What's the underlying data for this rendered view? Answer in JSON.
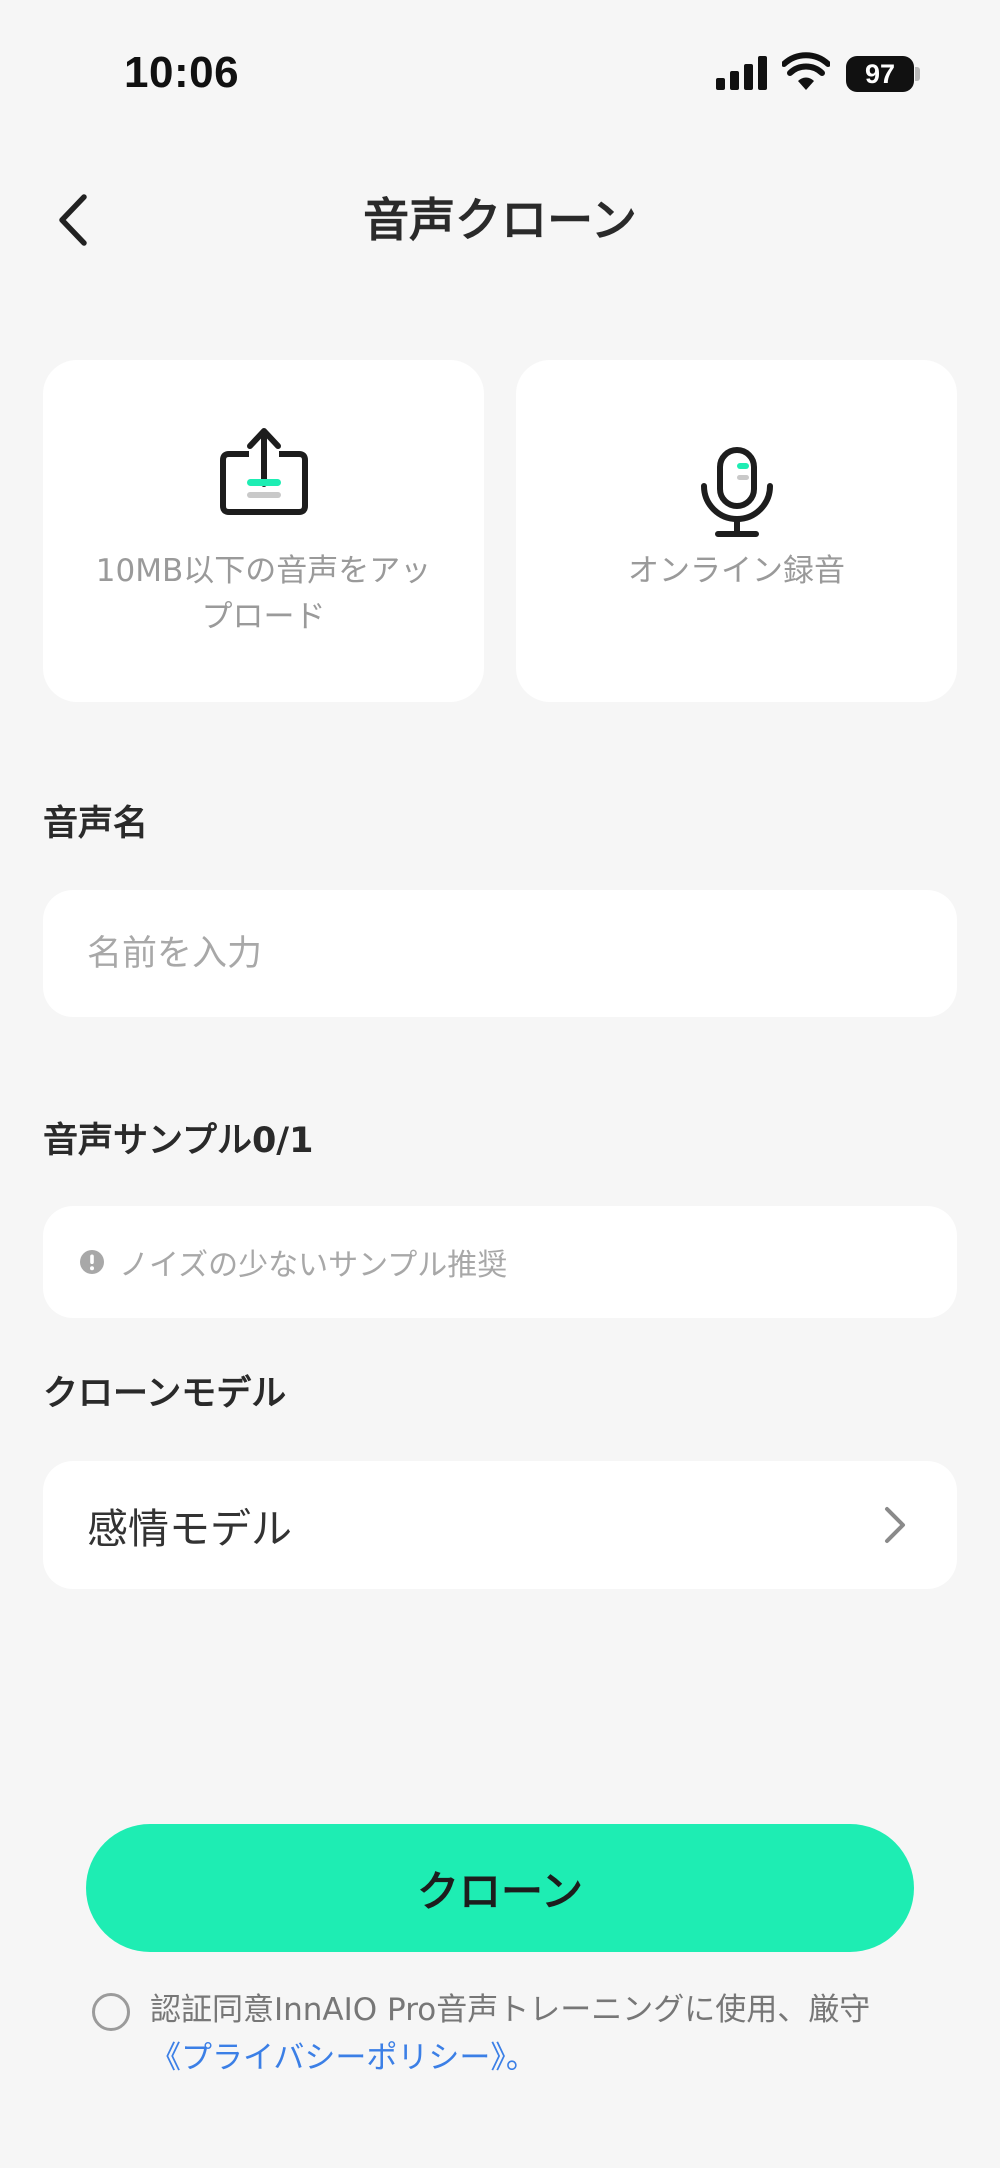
{
  "status_bar": {
    "time": "10:06",
    "battery": "97"
  },
  "header": {
    "title": "音声クローン"
  },
  "upload_card": {
    "label": "10MB以下の音声をアップロード"
  },
  "record_card": {
    "label": "オンライン録音"
  },
  "voice_name": {
    "label": "音声名",
    "placeholder": "名前を入力",
    "value": ""
  },
  "voice_sample": {
    "label": "音声サンプル0/1",
    "hint": "ノイズの少ないサンプル推奨"
  },
  "clone_model": {
    "label": "クローンモデル",
    "value": "感情モデル"
  },
  "clone_button": {
    "label": "クローン"
  },
  "agreement": {
    "text": "認証同意InnAIO Pro音声トレーニングに使用、厳守",
    "link": "《プライバシーポリシー》",
    "suffix": "。"
  },
  "colors": {
    "accent": "#1eedb3",
    "link": "#3b7fe6",
    "background": "#f6f6f6"
  }
}
